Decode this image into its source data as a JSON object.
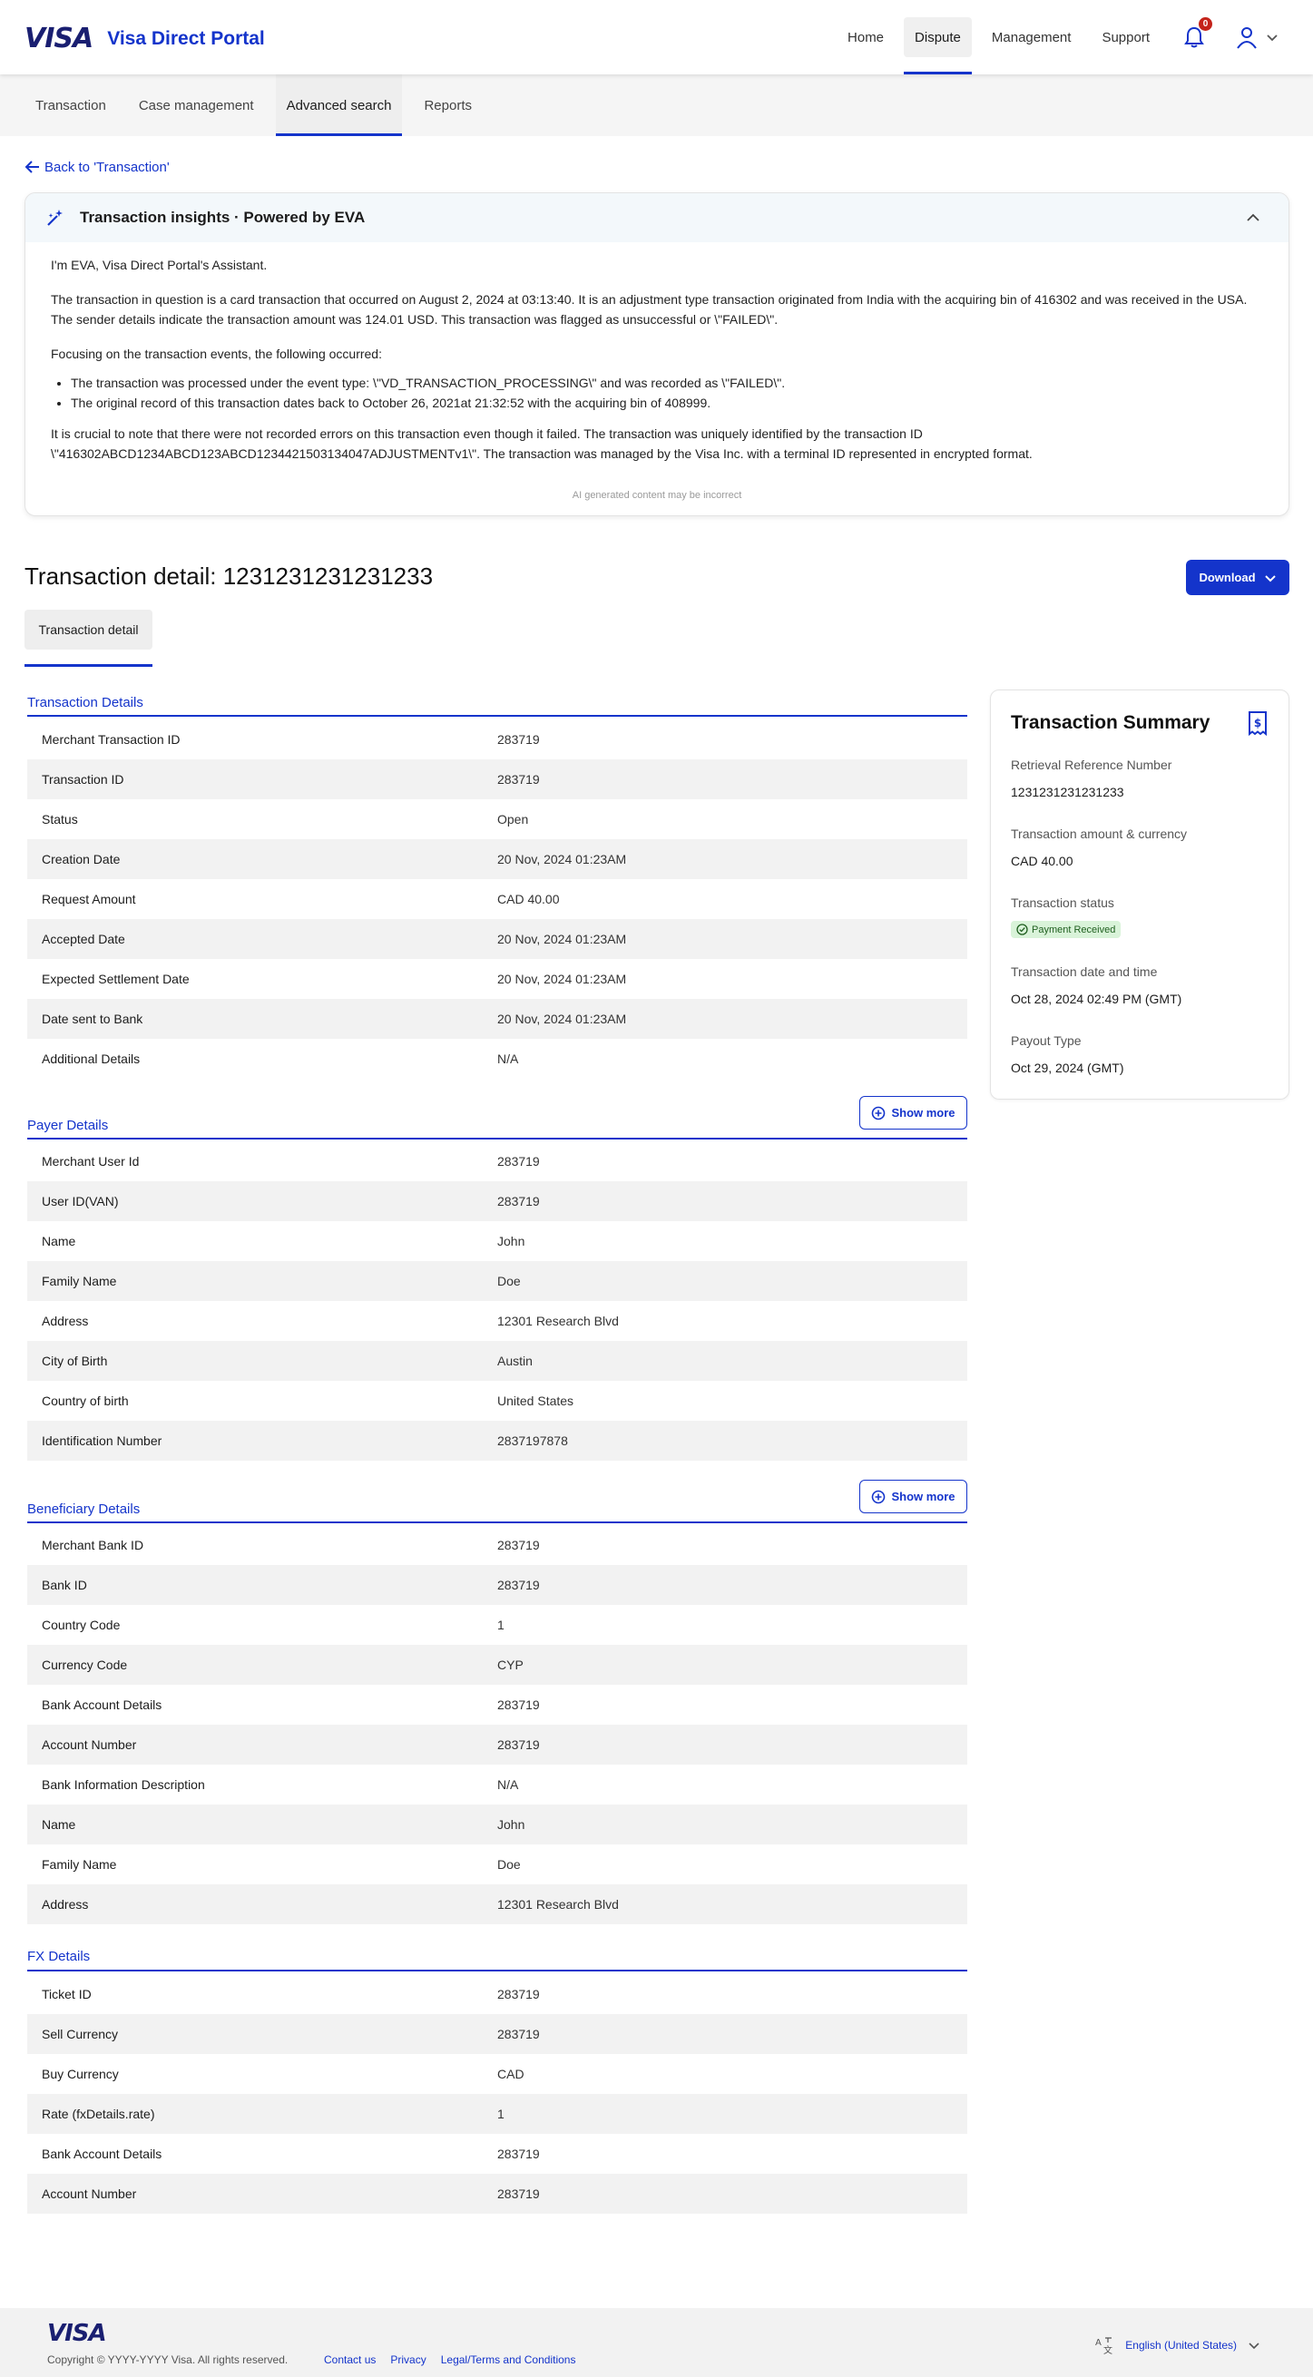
{
  "header": {
    "logo": "VISA",
    "title": "Visa Direct Portal",
    "nav": [
      "Home",
      "Dispute",
      "Management",
      "Support"
    ],
    "notifications": "0"
  },
  "subnav": [
    "Transaction",
    "Case management",
    "Advanced search",
    "Reports"
  ],
  "back_link": "Back to 'Transaction'",
  "eva": {
    "title": "Transaction insights · Powered by EVA",
    "intro": "I'm EVA, Visa Direct Portal's Assistant.",
    "p1": "The transaction in question is a card transaction that occurred on August 2, 2024 at 03:13:40. It is an adjustment type transaction originated from India with the acquiring bin of 416302 and was received in the USA. The sender details indicate the transaction amount was 124.01 USD. This transaction was flagged as unsuccessful or \\\"FAILED\\\".",
    "p2": "Focusing on the transaction events, the following occurred:",
    "bullets": [
      "The transaction was processed under the event type: \\\"VD_TRANSACTION_PROCESSING\\\" and was recorded as \\\"FAILED\\\".",
      "The original record of this transaction dates back to October 26, 2021at 21:32:52 with the acquiring bin of 408999."
    ],
    "p3": "It is crucial to note that there were not recorded errors on this transaction even though it failed. The transaction was uniquely identified by the transaction ID \\\"416302ABCD1234ABCD123ABCD1234421503134047ADJUSTMENTv1\\\". The transaction was managed by the Visa Inc. with a terminal ID represented in encrypted format.",
    "disclaimer": "AI generated content may be incorrect"
  },
  "page": {
    "title": "Transaction detail: 1231231231231233",
    "download": "Download",
    "tab": "Transaction detail",
    "show_more": "Show more"
  },
  "sections": {
    "transaction": {
      "title": "Transaction Details",
      "rows": [
        [
          "Merchant Transaction ID",
          "283719"
        ],
        [
          "Transaction ID",
          "283719"
        ],
        [
          "Status",
          "Open"
        ],
        [
          "Creation Date",
          "20 Nov, 2024 01:23AM"
        ],
        [
          "Request Amount",
          "CAD 40.00"
        ],
        [
          "Accepted Date",
          "20 Nov, 2024 01:23AM"
        ],
        [
          "Expected Settlement Date",
          "20 Nov, 2024 01:23AM"
        ],
        [
          "Date sent to Bank",
          "20 Nov, 2024 01:23AM"
        ],
        [
          "Additional Details",
          "N/A"
        ]
      ]
    },
    "payer": {
      "title": "Payer Details",
      "rows": [
        [
          "Merchant User Id",
          "283719"
        ],
        [
          "User ID(VAN)",
          "283719"
        ],
        [
          "Name",
          "John"
        ],
        [
          "Family Name",
          "Doe"
        ],
        [
          "Address",
          "12301 Research Blvd"
        ],
        [
          "City of Birth",
          "Austin"
        ],
        [
          "Country of birth",
          "United States"
        ],
        [
          "Identification Number",
          "2837197878"
        ]
      ]
    },
    "beneficiary": {
      "title": "Beneficiary Details",
      "rows": [
        [
          "Merchant Bank ID",
          "283719"
        ],
        [
          "Bank ID",
          "283719"
        ],
        [
          "Country Code",
          "1"
        ],
        [
          "Currency Code",
          "CYP"
        ],
        [
          "Bank Account Details",
          "283719"
        ],
        [
          "Account Number",
          "283719"
        ],
        [
          "Bank Information Description",
          "N/A"
        ],
        [
          "Name",
          "John"
        ],
        [
          "Family Name",
          "Doe"
        ],
        [
          "Address",
          "12301 Research Blvd"
        ]
      ]
    },
    "fx": {
      "title": "FX Details",
      "rows": [
        [
          "Ticket ID",
          "283719"
        ],
        [
          "Sell Currency",
          "283719"
        ],
        [
          "Buy Currency",
          "CAD"
        ],
        [
          "Rate (fxDetails.rate)",
          "1"
        ],
        [
          "Bank Account Details",
          "283719"
        ],
        [
          "Account Number",
          "283719"
        ]
      ]
    }
  },
  "summary": {
    "title": "Transaction Summary",
    "items": [
      {
        "label": "Retrieval Reference Number",
        "value": "1231231231231233"
      },
      {
        "label": "Transaction amount & currency",
        "value": "CAD 40.00"
      },
      {
        "label": "Transaction status",
        "value": "Payment Received"
      },
      {
        "label": "Transaction date and time",
        "value": "Oct 28, 2024 02:49 PM (GMT)"
      },
      {
        "label": "Payout Type",
        "value": "Oct 29, 2024 (GMT)"
      }
    ]
  },
  "footer": {
    "logo": "VISA",
    "copyright": "Copyright © YYYY-YYYY Visa. All rights reserved.",
    "links": [
      "Contact us",
      "Privacy",
      "Legal/Terms and Conditions"
    ],
    "language": "English (United States)"
  },
  "colors": {
    "brand": "#1434cb",
    "logo": "#1a1f71",
    "badge": "#c4231a",
    "status_bg": "#d9f3d9"
  }
}
